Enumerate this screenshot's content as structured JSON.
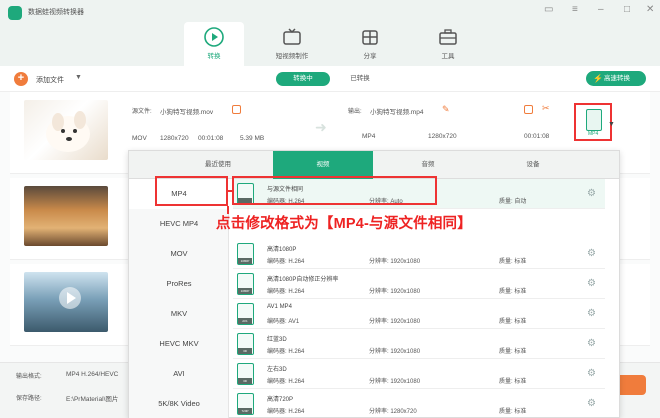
{
  "window": {
    "title": "数据蛙视频转换器",
    "tabs": [
      {
        "label": "转换",
        "icon": "convert-icon",
        "active": true
      },
      {
        "label": "短视频制作",
        "icon": "tv-icon",
        "active": false
      },
      {
        "label": "分享",
        "icon": "share-icon",
        "active": false
      },
      {
        "label": "工具",
        "icon": "toolbox-icon",
        "active": false
      }
    ],
    "accent_color": "#1ea97c"
  },
  "toolbar": {
    "add_label": "添加文件",
    "seg_converting": "转换中",
    "seg_converted": "已转换",
    "speed_label": "高速转换"
  },
  "file1": {
    "source_label": "源文件:",
    "source_name": "小狗特写视频.mov",
    "output_label": "输出:",
    "output_name": "小狗特写视频.mp4",
    "src_format": "MOV",
    "src_res": "1280x720",
    "src_dur": "00:01:08",
    "src_size": "5.39 MB",
    "out_format": "MP4",
    "out_res": "1280x720",
    "out_dur": "00:01:08",
    "format_badge": "MP4"
  },
  "bottom": {
    "output_format_label": "输出格式:",
    "output_format_value": "MP4 H.264/HEVC",
    "save_label": "保存路径:",
    "save_value": "E:\\PrMaterial\\图片"
  },
  "panel": {
    "tabs": [
      "最近使用",
      "视频",
      "音频",
      "设备"
    ],
    "active_tab": 1,
    "formats": [
      "MP4",
      "HEVC MP4",
      "MOV",
      "ProRes",
      "MKV",
      "HEVC MKV",
      "AVI",
      "5K/8K Video"
    ],
    "selected_format": 0,
    "items": [
      {
        "name": "与源文件相同",
        "enc": "编码器:  H.264",
        "res": "分辨率:  Auto",
        "q": "质量:  自动",
        "tag": ""
      },
      {
        "name": "高清1080P",
        "enc": "编码器:  H.264",
        "res": "分辨率:  1920x1080",
        "q": "质量:  标准",
        "tag": "1080P"
      },
      {
        "name": "高清1080P自动修正分辨率",
        "enc": "编码器:  H.264",
        "res": "分辨率:  1920x1080",
        "q": "质量:  标准",
        "tag": "1080P"
      },
      {
        "name": "AV1 MP4",
        "enc": "编码器:  AV1",
        "res": "分辨率:  1920x1080",
        "q": "质量:  标准",
        "tag": "AV1"
      },
      {
        "name": "红蓝3D",
        "enc": "编码器:  H.264",
        "res": "分辨率:  1920x1080",
        "q": "质量:  标准",
        "tag": "3D"
      },
      {
        "name": "左右3D",
        "enc": "编码器:  H.264",
        "res": "分辨率:  1920x1080",
        "q": "质量:  标准",
        "tag": "3D"
      },
      {
        "name": "高清720P",
        "enc": "编码器:  H.264",
        "res": "分辨率:  1280x720",
        "q": "质量:  标准",
        "tag": "720P"
      }
    ]
  },
  "annotation": "点击修改格式为【MP4-与源文件相同】"
}
